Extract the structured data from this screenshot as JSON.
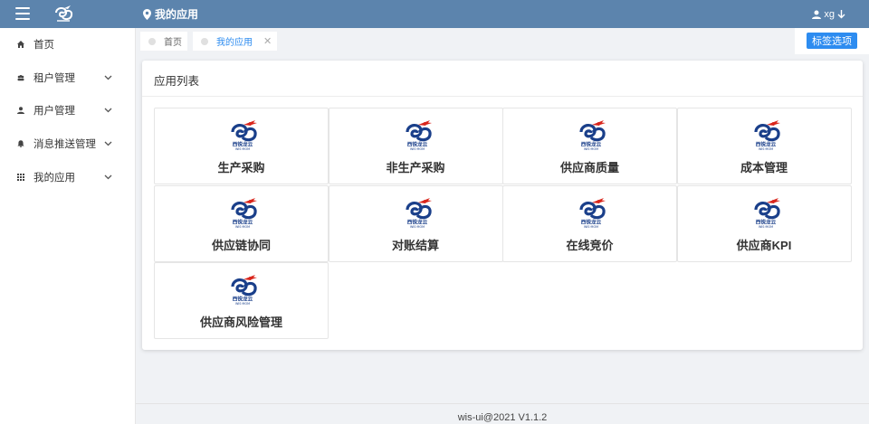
{
  "header": {
    "page_title": "我的应用",
    "username": "xg"
  },
  "sidebar": {
    "items": [
      {
        "label": "首页",
        "icon": "home-icon",
        "expandable": false
      },
      {
        "label": "租户管理",
        "icon": "group-icon",
        "expandable": true
      },
      {
        "label": "用户管理",
        "icon": "user-icon",
        "expandable": true
      },
      {
        "label": "消息推送管理",
        "icon": "bell-icon",
        "expandable": true
      },
      {
        "label": "我的应用",
        "icon": "grid-icon",
        "expandable": true
      }
    ]
  },
  "tabs": [
    {
      "label": "首页",
      "active": false
    },
    {
      "label": "我的应用",
      "active": true,
      "closable": true
    }
  ],
  "tag_options_label": "标签选项",
  "main": {
    "title": "应用列表",
    "apps": [
      {
        "label": "生产采购"
      },
      {
        "label": "非生产采购"
      },
      {
        "label": "供应商质量"
      },
      {
        "label": "成本管理"
      },
      {
        "label": "供应链协同"
      },
      {
        "label": "对账结算"
      },
      {
        "label": "在线竞价"
      },
      {
        "label": "供应商KPI"
      },
      {
        "label": "供应商风险管理"
      }
    ],
    "app_logo": {
      "brand_text": "西锐龙云",
      "brand_sub": "WIS·MOM"
    }
  },
  "footer": {
    "text": "wis-ui@2021 V1.1.2"
  },
  "colors": {
    "header_bg": "#5c84ad",
    "accent": "#2d8cf0",
    "logo_blue": "#1a3f8a",
    "logo_red": "#d9261c"
  }
}
